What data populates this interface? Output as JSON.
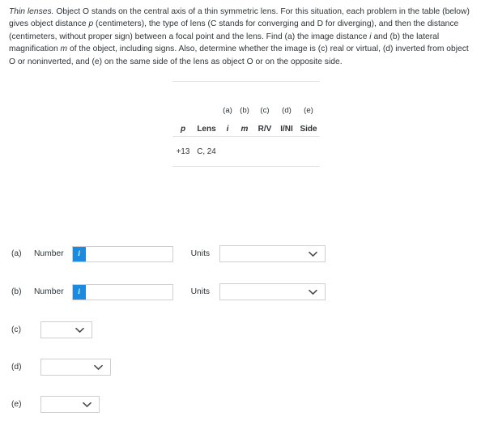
{
  "problem": {
    "lead": "Thin lenses.",
    "body_part1": " Object O stands on the central axis of a thin symmetric lens. For this situation, each problem in the table (below) gives object distance ",
    "var_p": "p",
    "body_part2": " (centimeters), the type of lens (C stands for converging and D for diverging), and then the distance (centimeters, without proper sign) between a focal point and the lens. Find (a) the image distance ",
    "var_i": "i",
    "body_part3": " and (b) the lateral magnification ",
    "var_m": "m",
    "body_part4": " of the object, including signs. Also, determine whether the image is (c) real or virtual, (d) inverted from object O or noninverted, and (e) on the same side of the lens as object O or on the opposite side."
  },
  "table": {
    "group_headers": [
      "",
      "",
      "(a)",
      "(b)",
      "(c)",
      "(d)",
      "(e)"
    ],
    "column_headers": [
      "p",
      "Lens",
      "i",
      "m",
      "R/V",
      "I/NI",
      "Side"
    ],
    "rows": [
      [
        "+13",
        "C, 24",
        "",
        "",
        "",
        "",
        ""
      ]
    ]
  },
  "answers": {
    "a": {
      "part": "(a)",
      "number_label": "Number",
      "info_icon": "i",
      "number_value": "",
      "units_label": "Units",
      "units_value": ""
    },
    "b": {
      "part": "(b)",
      "number_label": "Number",
      "info_icon": "i",
      "number_value": "",
      "units_label": "Units",
      "units_value": ""
    },
    "c": {
      "part": "(c)",
      "value": ""
    },
    "d": {
      "part": "(d)",
      "value": ""
    },
    "e": {
      "part": "(e)",
      "value": ""
    }
  },
  "colors": {
    "accent_blue": "#1c8ade",
    "text": "#2f3437",
    "border": "#cfcfcf",
    "rule": "#e2e2e2"
  }
}
